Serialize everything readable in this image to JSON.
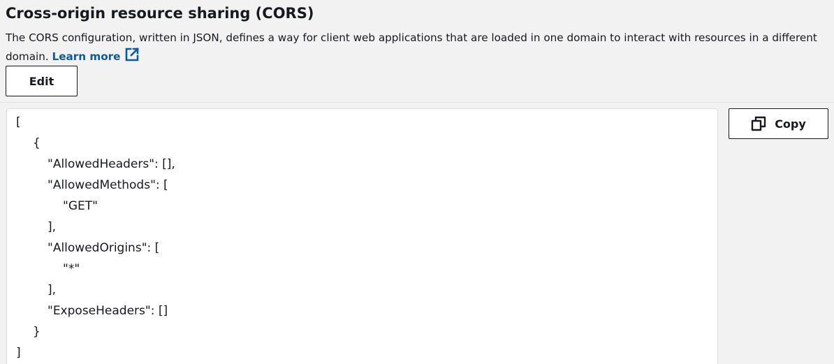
{
  "section": {
    "title": "Cross-origin resource sharing (CORS)",
    "description": "The CORS configuration, written in JSON, defines a way for client web applications that are loaded in one domain to interact with resources in a different domain.",
    "learn_more_label": "Learn more",
    "learn_more_icon": "external-link-icon",
    "edit_label": "Edit"
  },
  "code_viewer": {
    "lines": [
      "[",
      "{",
      "\"AllowedHeaders\": [],",
      "\"AllowedMethods\": [",
      "\"GET\"",
      "],",
      "\"AllowedOrigins\": [",
      "\"*\"",
      "],",
      "\"ExposeHeaders\": []",
      "}",
      "]"
    ],
    "copy_label": "Copy",
    "copy_icon": "copy-icon"
  },
  "colors": {
    "link": "#0b5a9f",
    "text": "#16191f",
    "header_background": "#f2f2f2",
    "panel_background": "#ffffff"
  }
}
